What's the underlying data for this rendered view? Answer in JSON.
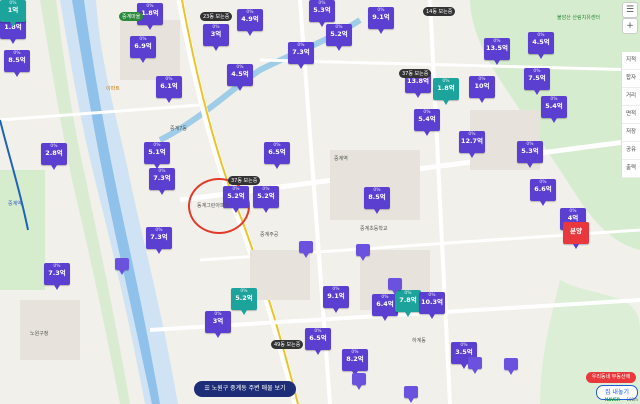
{
  "markers": [
    {
      "pct": "0%",
      "price": "1.8억"
    },
    {
      "pct": "0%",
      "price": "4.9억"
    },
    {
      "pct": "0%",
      "price": "5.3억"
    },
    {
      "pct": "0%",
      "price": "9.1억"
    },
    {
      "pct": "0%",
      "price": "6.9억"
    },
    {
      "pct": "0%",
      "price": "3억"
    },
    {
      "pct": "0%",
      "price": "5.2억"
    },
    {
      "pct": "0%",
      "price": "13.5억"
    },
    {
      "pct": "0%",
      "price": "4.5억"
    },
    {
      "pct": "0%",
      "price": "8.5억"
    },
    {
      "pct": "0%",
      "price": "7.3억"
    },
    {
      "pct": "0%",
      "price": "4.5억"
    },
    {
      "pct": "0%",
      "price": "6.1억"
    },
    {
      "pct": "0%",
      "price": "13.8억"
    },
    {
      "pct": "0%",
      "price": "10억"
    },
    {
      "pct": "0%",
      "price": "7.5억"
    },
    {
      "pct": "0%",
      "price": "1.8억"
    },
    {
      "pct": "0%",
      "price": "5.4억"
    },
    {
      "pct": "0%",
      "price": "5.4억"
    },
    {
      "pct": "0%",
      "price": "2.8억"
    },
    {
      "pct": "0%",
      "price": "5.1억"
    },
    {
      "pct": "0%",
      "price": "6.5억"
    },
    {
      "pct": "0%",
      "price": "12.7억"
    },
    {
      "pct": "0%",
      "price": "5.3억"
    },
    {
      "pct": "0%",
      "price": "7.3억"
    },
    {
      "pct": "0%",
      "price": "5.2억"
    },
    {
      "pct": "0%",
      "price": "5.2억"
    },
    {
      "pct": "0%",
      "price": "8.5억"
    },
    {
      "pct": "0%",
      "price": "6.6억"
    },
    {
      "pct": "0%",
      "price": "7.3억"
    },
    {
      "pct": "0%",
      "price": "7.3억"
    },
    {
      "pct": "0%",
      "price": "5.2억"
    },
    {
      "pct": "0%",
      "price": "9.1억"
    },
    {
      "pct": "0%",
      "price": "6.4억"
    },
    {
      "pct": "0%",
      "price": "7.8억"
    },
    {
      "pct": "0%",
      "price": "10.3억"
    },
    {
      "pct": "0%",
      "price": "3억"
    },
    {
      "pct": "0%",
      "price": "6.5억"
    },
    {
      "pct": "0%",
      "price": "3.5억"
    },
    {
      "pct": "0%",
      "price": "8.2억"
    },
    {
      "pct": "0%",
      "price": "4억"
    },
    {
      "pct": "0%",
      "price": "1.8억"
    },
    {
      "pct": "0%",
      "price": "1억"
    }
  ],
  "pills": [
    "23동 보는중",
    "14동 보는중",
    "37동 보는중",
    "37동 보는중",
    "49동 보는중",
    "중계마을"
  ],
  "labels": [
    "중계7동",
    "동계그린아파트",
    "중계주공",
    "불암산 산림치유센터",
    "이마트",
    "중계역",
    "중계역",
    "하계동",
    "노원구청",
    "중계초등학교"
  ],
  "controls": [
    "지적",
    "합자",
    "거리",
    "면적",
    "저장",
    "공유",
    "출력"
  ],
  "location_pin": "분양",
  "banner": "☰ 노원구 중계동 주변 매물 보기",
  "realtor_pill": "우리동네 부동산에",
  "sell_button": "집 내놓기",
  "brand": "NAVER",
  "scale": "100m"
}
